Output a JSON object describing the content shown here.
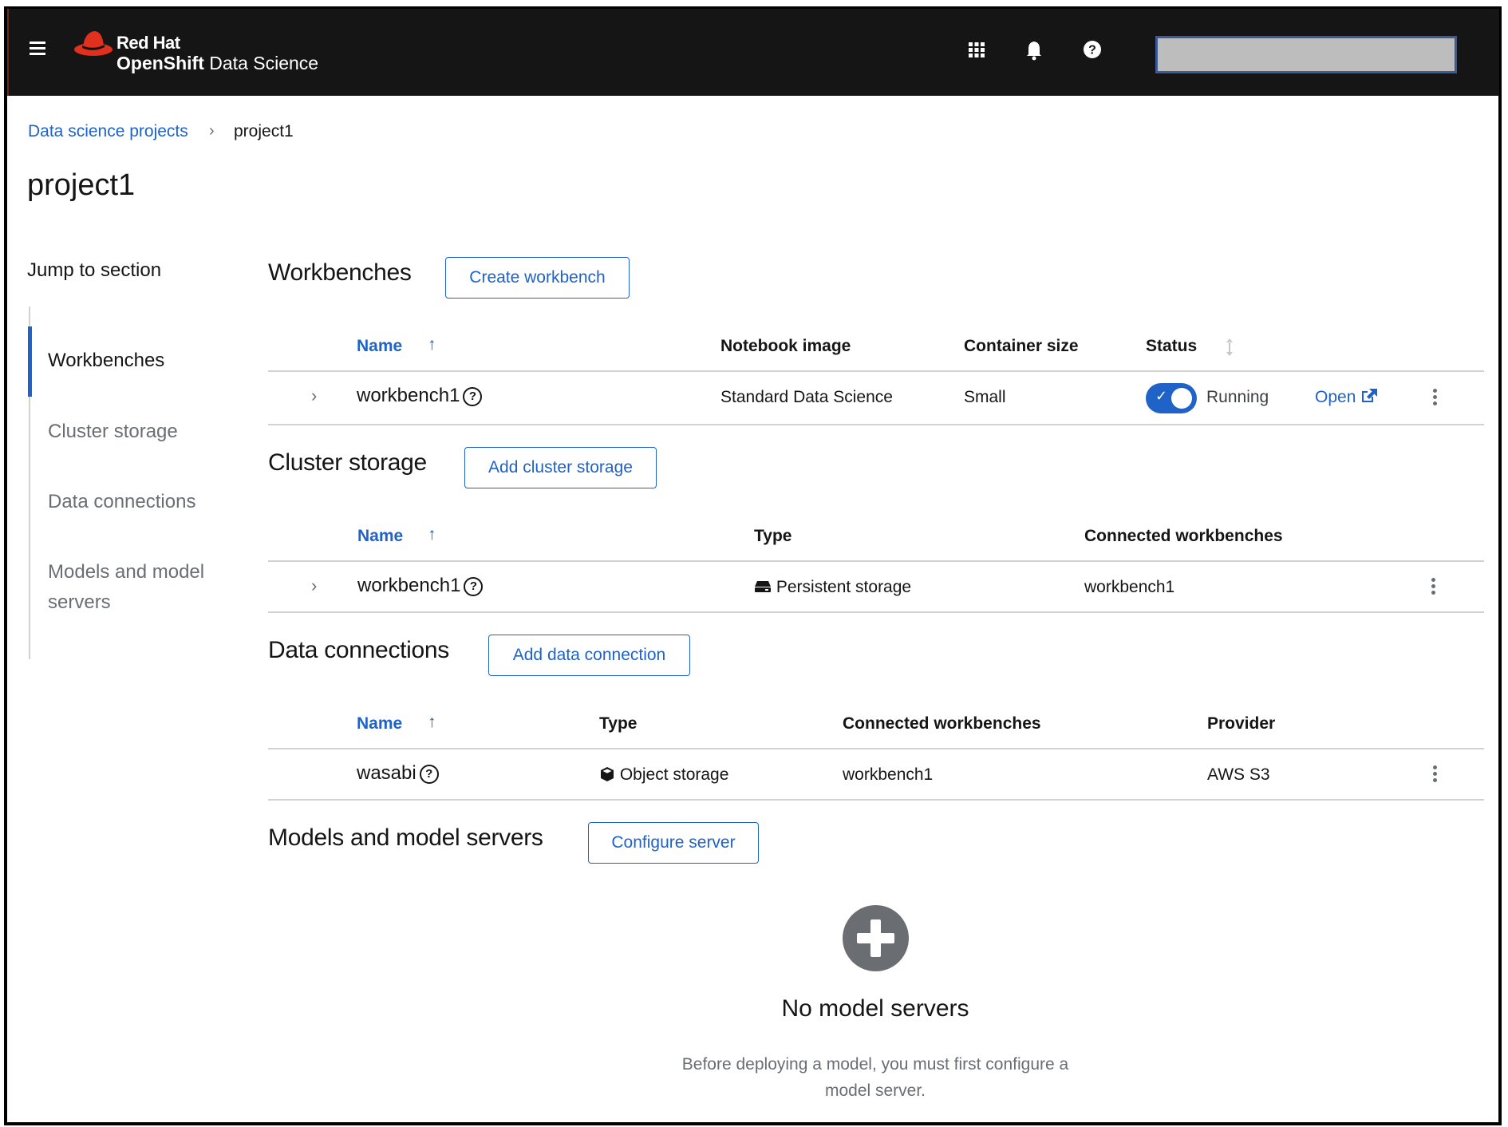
{
  "masthead": {
    "brand_line1": "Red Hat",
    "brand_line2_bold": "OpenShift",
    "brand_line2_rest": " Data Science",
    "icons": [
      "hamburger-menu-icon",
      "app-launcher-grid-icon",
      "bell-icon",
      "help-icon"
    ],
    "user_menu_value": ""
  },
  "breadcrumb": {
    "parent": "Data science projects",
    "separator": "›",
    "current": "project1"
  },
  "page": {
    "title": "project1"
  },
  "jump_nav": {
    "title": "Jump to section",
    "items": [
      {
        "label": "Workbenches",
        "active": true
      },
      {
        "label": "Cluster storage",
        "active": false
      },
      {
        "label": "Data connections",
        "active": false
      },
      {
        "label": "Models and model",
        "label_line2": "servers",
        "active": false
      }
    ]
  },
  "colors": {
    "accent": "#1f62c8",
    "masthead": "#151515",
    "muted": "#6a6e73",
    "border": "#d2d2d2"
  },
  "workbenches": {
    "title": "Workbenches",
    "button": "Create workbench",
    "columns": [
      "Name",
      "Notebook image",
      "Container size",
      "Status"
    ],
    "sort_arrow": "↑",
    "rows": [
      {
        "name": "workbench1",
        "notebook_image": "Standard Data Science",
        "container_size": "Small",
        "status": "Running",
        "status_enabled": true,
        "open_label": "Open"
      }
    ]
  },
  "cluster_storage": {
    "title": "Cluster storage",
    "button": "Add cluster storage",
    "columns": [
      "Name",
      "Type",
      "Connected workbenches"
    ],
    "rows": [
      {
        "name": "workbench1",
        "type": "Persistent storage",
        "connected": "workbench1"
      }
    ]
  },
  "data_connections": {
    "title": "Data connections",
    "button": "Add data connection",
    "columns": [
      "Name",
      "Type",
      "Connected workbenches",
      "Provider"
    ],
    "rows": [
      {
        "name": "wasabi",
        "type": "Object storage",
        "connected": "workbench1",
        "provider": "AWS S3"
      }
    ]
  },
  "models": {
    "title": "Models and model servers",
    "button": "Configure server",
    "empty_title": "No model servers",
    "empty_desc_line1": "Before deploying a model, you must first configure a",
    "empty_desc_line2": "model server."
  }
}
